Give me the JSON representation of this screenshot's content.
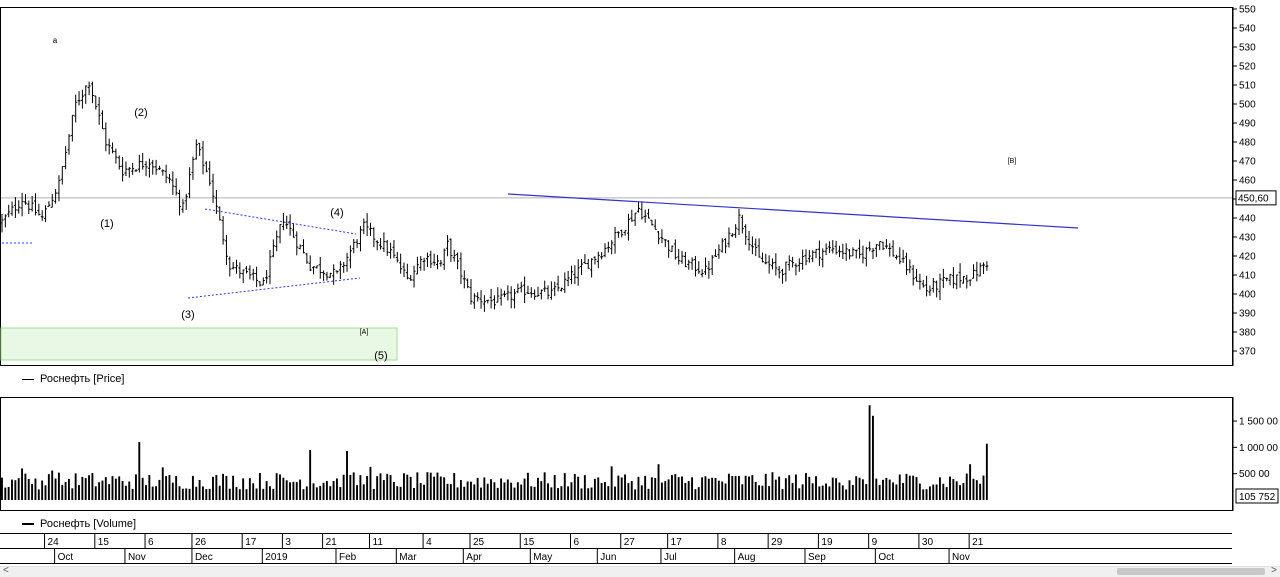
{
  "legend": {
    "price": "Роснефть [Price]",
    "volume": "Роснефть [Volume]"
  },
  "colors": {
    "bars": "#000000",
    "trendline": "#3333cc",
    "triangle": "#2a3de0",
    "zone_fill": "#e8f8e4",
    "zone_border": "#9edf8f",
    "current_line": "#b0b0b0"
  },
  "chart_data": [
    {
      "type": "ohlc",
      "series_name": "Роснефть [Price]",
      "ylim": [
        360,
        550
      ],
      "yticks": [
        370,
        380,
        390,
        400,
        410,
        420,
        430,
        440,
        450,
        460,
        470,
        480,
        490,
        500,
        510,
        520,
        530,
        540,
        550
      ],
      "current_value": 450.6,
      "current_label": "450,60",
      "trading_days": 295,
      "close_path": [
        [
          0,
          438
        ],
        [
          6,
          450
        ],
        [
          12,
          440
        ],
        [
          17,
          458
        ],
        [
          22,
          500
        ],
        [
          26,
          512
        ],
        [
          31,
          480
        ],
        [
          36,
          465
        ],
        [
          44,
          470
        ],
        [
          50,
          460
        ],
        [
          54,
          445
        ],
        [
          58,
          478
        ],
        [
          62,
          460
        ],
        [
          68,
          415
        ],
        [
          78,
          405
        ],
        [
          84,
          440
        ],
        [
          92,
          415
        ],
        [
          100,
          410
        ],
        [
          108,
          435
        ],
        [
          116,
          422
        ],
        [
          121,
          408
        ],
        [
          126,
          420
        ],
        [
          131,
          416
        ],
        [
          133,
          426
        ],
        [
          136,
          415
        ],
        [
          140,
          398
        ],
        [
          148,
          396
        ],
        [
          156,
          402
        ],
        [
          164,
          400
        ],
        [
          172,
          412
        ],
        [
          180,
          424
        ],
        [
          186,
          436
        ],
        [
          190,
          445
        ],
        [
          196,
          432
        ],
        [
          202,
          418
        ],
        [
          210,
          412
        ],
        [
          216,
          428
        ],
        [
          220,
          440
        ],
        [
          226,
          418
        ],
        [
          232,
          412
        ],
        [
          240,
          420
        ],
        [
          248,
          424
        ],
        [
          256,
          420
        ],
        [
          262,
          428
        ],
        [
          268,
          418
        ],
        [
          276,
          402
        ],
        [
          282,
          407
        ],
        [
          290,
          410
        ],
        [
          296,
          420
        ],
        [
          302,
          418
        ],
        [
          306,
          435
        ],
        [
          312,
          428
        ],
        [
          320,
          416
        ],
        [
          326,
          410
        ],
        [
          334,
          416
        ],
        [
          340,
          425
        ],
        [
          344,
          432
        ],
        [
          346,
          450
        ]
      ],
      "annotations": [
        "a",
        "(1)",
        "(2)",
        "(3)",
        "(4)",
        "(5)",
        "[A]",
        "[B]"
      ]
    },
    {
      "type": "bar",
      "series_name": "Роснефть [Volume]",
      "ylim": [
        0,
        1900000
      ],
      "yticks": [
        500000,
        1000000,
        1500000
      ],
      "ytick_labels": [
        "500 00",
        "1 000 00",
        "1 500 00"
      ],
      "last_value_label": "105 752"
    }
  ],
  "xaxis": {
    "days": [
      {
        "label": "24",
        "bar": 13
      },
      {
        "label": "15",
        "bar": 28
      },
      {
        "label": "6",
        "bar": 43
      },
      {
        "label": "26",
        "bar": 57
      },
      {
        "label": "17",
        "bar": 72
      },
      {
        "label": "3",
        "bar": 84
      },
      {
        "label": "21",
        "bar": 96
      },
      {
        "label": "11",
        "bar": 110
      },
      {
        "label": "4",
        "bar": 126
      },
      {
        "label": "25",
        "bar": 140
      },
      {
        "label": "15",
        "bar": 155
      },
      {
        "label": "6",
        "bar": 170
      },
      {
        "label": "27",
        "bar": 185
      },
      {
        "label": "17",
        "bar": 199
      },
      {
        "label": "8",
        "bar": 214
      },
      {
        "label": "29",
        "bar": 229
      },
      {
        "label": "19",
        "bar": 244
      },
      {
        "label": "9",
        "bar": 259
      },
      {
        "label": "30",
        "bar": 274
      },
      {
        "label": "21",
        "bar": 289
      }
    ],
    "months": [
      {
        "label": "Oct",
        "bar": 16
      },
      {
        "label": "Nov",
        "bar": 37
      },
      {
        "label": "Dec",
        "bar": 57
      },
      {
        "label": "2019",
        "bar": 78
      },
      {
        "label": "Feb",
        "bar": 100
      },
      {
        "label": "Mar",
        "bar": 118
      },
      {
        "label": "Apr",
        "bar": 138
      },
      {
        "label": "May",
        "bar": 158
      },
      {
        "label": "Jun",
        "bar": 178
      },
      {
        "label": "Jul",
        "bar": 197
      },
      {
        "label": "Aug",
        "bar": 219
      },
      {
        "label": "Sep",
        "bar": 240
      },
      {
        "label": "Oct",
        "bar": 261
      },
      {
        "label": "Nov",
        "bar": 283
      }
    ]
  },
  "scroll": {
    "left": "<",
    "right": ">"
  }
}
